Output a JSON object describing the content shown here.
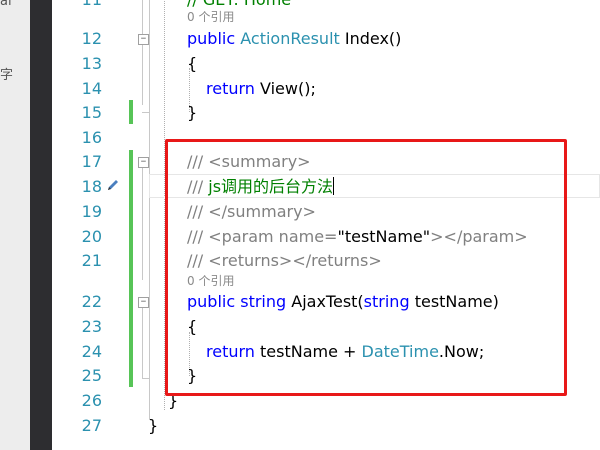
{
  "left_panel": {
    "text_a": "al",
    "text_b": "字"
  },
  "editor": {
    "line11": {
      "num": "11",
      "code": "// GET: Home"
    },
    "ref1": "0 个引用",
    "line12": {
      "num": "12",
      "kw": "public",
      "type": "ActionResult",
      "rest": " Index()"
    },
    "line13": {
      "num": "13",
      "code": "{"
    },
    "line14": {
      "num": "14",
      "kw": "return",
      "rest": " View();"
    },
    "line15": {
      "num": "15",
      "code": "}"
    },
    "line16": {
      "num": "16"
    },
    "line17": {
      "num": "17",
      "slashes": "///",
      "tag": " <summary>"
    },
    "line18": {
      "num": "18",
      "slashes": "///",
      "comment": " js调用的后台方法"
    },
    "line19": {
      "num": "19",
      "slashes": "///",
      "tag": " </summary>"
    },
    "line20": {
      "num": "20",
      "slashes": "///",
      "tag_open": " <param name=",
      "q1": "\"",
      "param": "testName",
      "q2": "\"",
      "tag_close": "></param>"
    },
    "line21": {
      "num": "21",
      "slashes": "///",
      "tag": " <returns></returns>"
    },
    "ref2": "0 个引用",
    "line22": {
      "num": "22",
      "kw1": "public",
      "kw2": "string",
      "mid": " AjaxTest(",
      "kw3": "string",
      "rest": " testName)"
    },
    "line23": {
      "num": "23",
      "code": "{"
    },
    "line24": {
      "num": "24",
      "kw": "return",
      "mid": " testName + ",
      "type": "DateTime",
      "rest": ".Now;"
    },
    "line25": {
      "num": "25",
      "code": "}"
    },
    "line26": {
      "num": "26",
      "code": "}"
    },
    "line27": {
      "num": "27",
      "code": "}"
    }
  },
  "colors": {
    "keyword": "#0000ff",
    "type": "#2b91af",
    "comment": "#008000",
    "doc": "#808080",
    "highlight": "#e81818",
    "change_bar": "#57c457"
  }
}
